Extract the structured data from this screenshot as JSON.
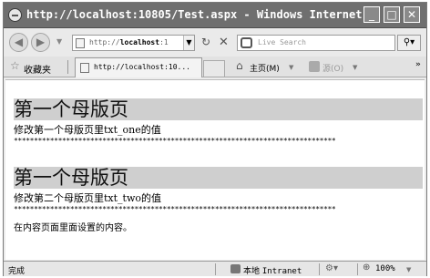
{
  "window": {
    "title": "http://localhost:10805/Test.aspx - Windows Internet ...",
    "min_glyph": "_",
    "max_glyph": "□",
    "close_glyph": "✕"
  },
  "address_bar": {
    "url_prefix": "http://",
    "url_host": "localhost",
    "url_rest": ":1",
    "search_placeholder": "Live Search"
  },
  "tabs_bar": {
    "favorites_label": "收藏夹",
    "tab_label": "http://localhost:10...",
    "home_label": "主页(M)",
    "feeds_label": "源(O)",
    "more_glyph": "»"
  },
  "content": {
    "sections": [
      {
        "heading": "第一个母版页",
        "text": "修改第一个母版页里txt_one的值",
        "stars": "********************************************************************************"
      },
      {
        "heading": "第一个母版页",
        "text": "修改第二个母版页里txt_two的值",
        "stars": "********************************************************************************"
      }
    ],
    "body_text": "在内容页面里面设置的内容。"
  },
  "status_bar": {
    "status": "完成",
    "zone_prefix": "本地",
    "zone_name": "Intranet",
    "zoom": "100%"
  }
}
